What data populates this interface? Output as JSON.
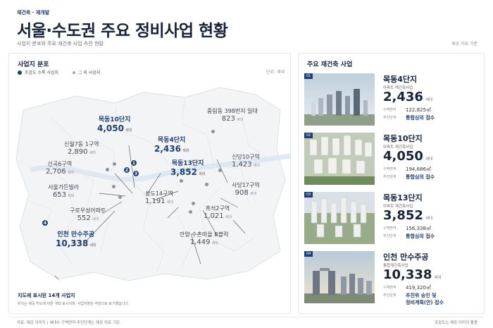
{
  "header": {
    "kicker": "재건축 · 재개발",
    "title": "서울·수도권 주요 정비사업 현황",
    "subtitle": "사업지 분포와 주요 재건축 사업 추진 현황",
    "source_top": "제공 자료 기준"
  },
  "map": {
    "title": "사업지 분포",
    "legend_key": "조감도 수록 사업지",
    "legend_other": "그 외 사업지",
    "unit": "단위: 세대",
    "household_unit": "세대",
    "footer_title": "지도에 표시된 14개 사업지",
    "footer_note": "위치는 제공 지도에 따른 개략 표시이며, 사업지명은 약칭으로 표기했습니다.",
    "sites": [
      {
        "name": "중림동 398번지 일대",
        "count": "823"
      },
      {
        "name": "신당10구역",
        "count": "1,423"
      },
      {
        "name": "사당17구역",
        "count": "908"
      },
      {
        "name": "신월7동 1구역",
        "count": "2,890"
      },
      {
        "name": "신곡6구역",
        "count": "2,706"
      },
      {
        "name": "서울가든빌라",
        "count": "653"
      },
      {
        "name": "구로우성아파트",
        "count": "552"
      },
      {
        "name": "상도14구역",
        "count": "1,191"
      },
      {
        "name": "흑석2구역",
        "count": "1,021"
      },
      {
        "name": "안양 수촌마을 B블럭",
        "count": "1,449"
      }
    ],
    "key_sites": [
      {
        "badge": "1",
        "name": "목동10단지",
        "count": "4,050"
      },
      {
        "badge": "2",
        "name": "목동4단지",
        "count": "2,436"
      },
      {
        "badge": "3",
        "name": "목동13단지",
        "count": "3,852"
      },
      {
        "badge": "4",
        "name": "인천 만수주공",
        "count": "10,338"
      }
    ]
  },
  "projects": {
    "title": "주요 재건축 사업",
    "area_label": "구역면적",
    "stage_label": "추진단계",
    "household_unit": "세대",
    "items": [
      {
        "num": "01",
        "name": "목동4단지",
        "type": "아파트 재건축사업",
        "count": "2,436",
        "area": "122,825㎡",
        "stage": "통합심의 접수"
      },
      {
        "num": "02",
        "name": "목동10단지",
        "type": "아파트 재건축사업",
        "count": "4,050",
        "area": "194,686㎡",
        "stage": "통합심의 접수"
      },
      {
        "num": "03",
        "name": "목동13단지",
        "type": "아파트 재건축사업",
        "count": "3,852",
        "area": "156,338㎡",
        "stage": "통합심의 접수"
      },
      {
        "num": "04",
        "name": "인천 만수주공",
        "type": "통합재건축사업",
        "count": "10,338",
        "area": "419,320㎡",
        "stage": "추진위 승인 및",
        "stage2": "정비계획(안) 접수"
      }
    ]
  },
  "footer": {
    "left": "자료: 제공 이미지  |  세대수·구역면적·추진단계는 제공 자료 기준",
    "right": "조감도는 제공 이미지 활용"
  },
  "colors": {
    "accent": "#1d3f73",
    "river": "#dce7f0",
    "map_bg": "#f1f3f5"
  }
}
